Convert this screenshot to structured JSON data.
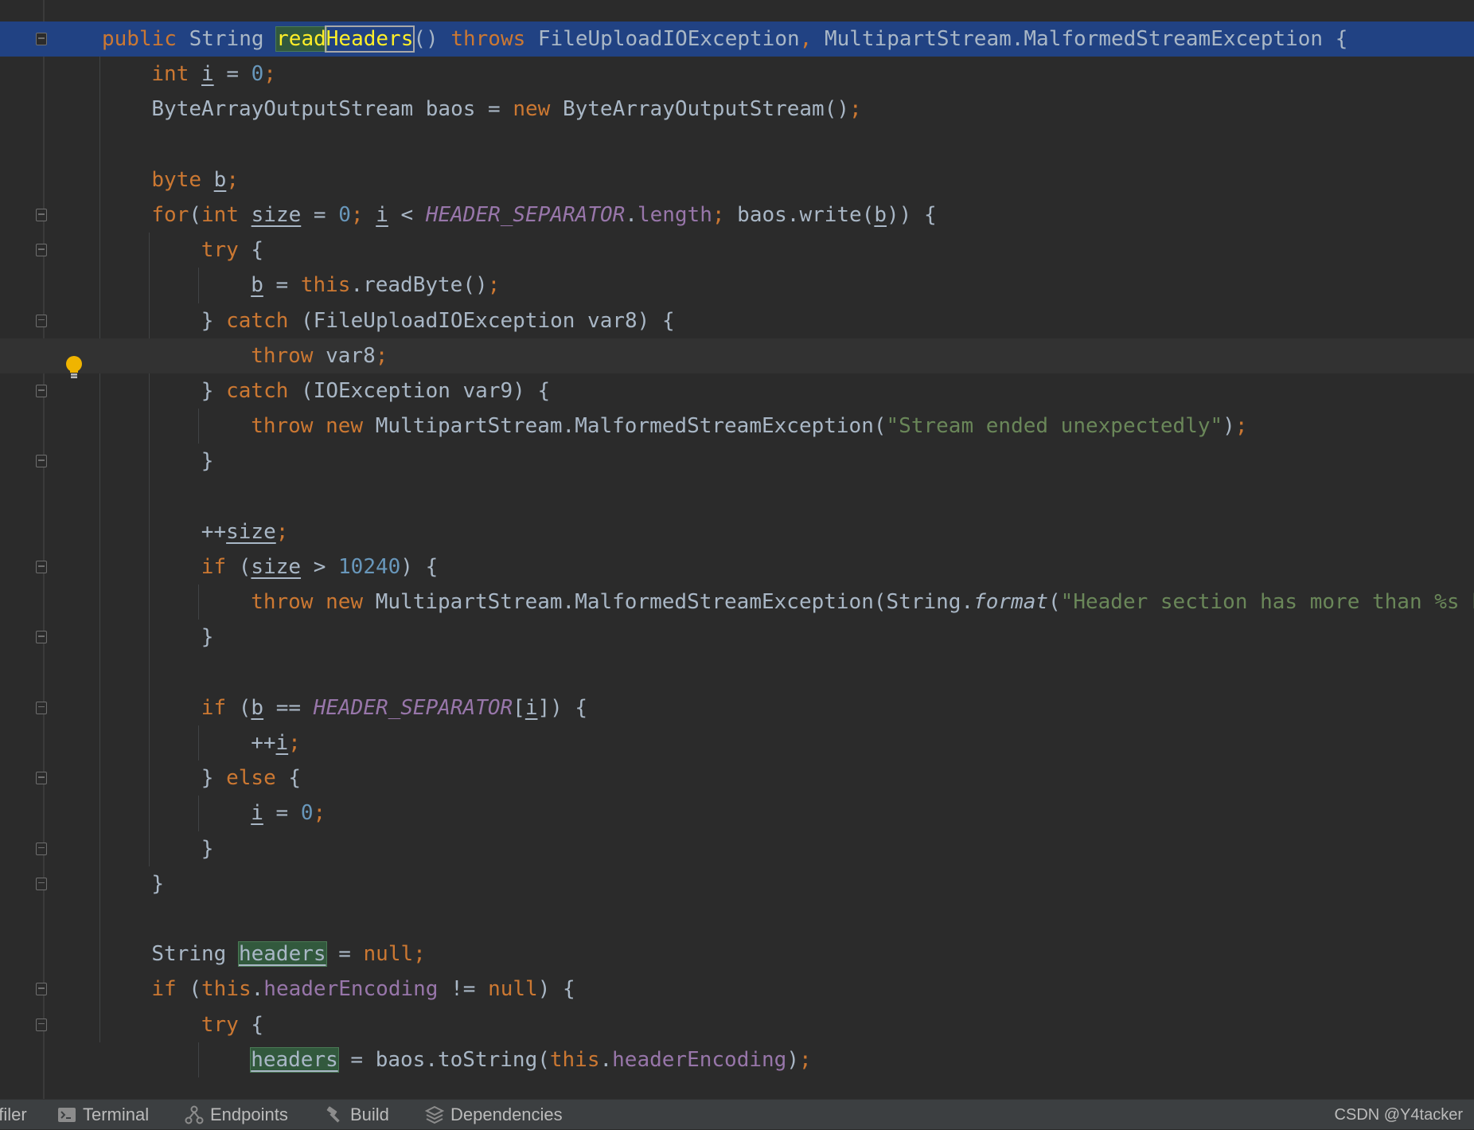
{
  "editor": {
    "lines": [
      {
        "indent": 0,
        "segs": [
          [
            "kw",
            "public "
          ],
          [
            "ty",
            "String "
          ],
          [
            "mh",
            "read"
          ],
          [
            "mh2",
            "Headers"
          ],
          [
            "ty",
            "() "
          ],
          [
            "kw",
            "throws "
          ],
          [
            "ty",
            "FileUploadIOException"
          ],
          [
            "kw",
            ", "
          ],
          [
            "ty",
            "MultipartStream.MalformedStreamException {"
          ]
        ]
      },
      {
        "indent": 1,
        "segs": [
          [
            "kw",
            "int "
          ],
          [
            "u",
            "i"
          ],
          [
            "ty",
            " = "
          ],
          [
            "num",
            "0"
          ],
          [
            "kw",
            ";"
          ]
        ]
      },
      {
        "indent": 1,
        "segs": [
          [
            "ty",
            "ByteArrayOutputStream baos = "
          ],
          [
            "kw",
            "new "
          ],
          [
            "ty",
            "ByteArrayOutputStream()"
          ],
          [
            "kw",
            ";"
          ]
        ]
      },
      {
        "indent": 1,
        "segs": []
      },
      {
        "indent": 1,
        "segs": [
          [
            "kw",
            "byte "
          ],
          [
            "u",
            "b"
          ],
          [
            "kw",
            ";"
          ]
        ]
      },
      {
        "indent": 1,
        "segs": [
          [
            "kw",
            "for"
          ],
          [
            "ty",
            "("
          ],
          [
            "kw",
            "int "
          ],
          [
            "u",
            "size"
          ],
          [
            "ty",
            " = "
          ],
          [
            "num",
            "0"
          ],
          [
            "kw",
            "; "
          ],
          [
            "u",
            "i"
          ],
          [
            "ty",
            " < "
          ],
          [
            "cst",
            "HEADER_SEPARATOR"
          ],
          [
            "ty",
            "."
          ],
          [
            "fld",
            "length"
          ],
          [
            "kw",
            "; "
          ],
          [
            "ty",
            "baos.write("
          ],
          [
            "u",
            "b"
          ],
          [
            "ty",
            ")) {"
          ]
        ]
      },
      {
        "indent": 2,
        "segs": [
          [
            "kw",
            "try "
          ],
          [
            "ty",
            "{"
          ]
        ]
      },
      {
        "indent": 3,
        "segs": [
          [
            "u",
            "b"
          ],
          [
            "ty",
            " = "
          ],
          [
            "kw",
            "this"
          ],
          [
            "ty",
            ".readByte()"
          ],
          [
            "kw",
            ";"
          ]
        ]
      },
      {
        "indent": 2,
        "segs": [
          [
            "ty",
            "} "
          ],
          [
            "kw",
            "catch "
          ],
          [
            "ty",
            "(FileUploadIOException var8) {"
          ]
        ]
      },
      {
        "indent": 3,
        "segs": [
          [
            "kw",
            "throw "
          ],
          [
            "ty",
            "var8"
          ],
          [
            "kw",
            ";"
          ]
        ]
      },
      {
        "indent": 2,
        "segs": [
          [
            "ty",
            "} "
          ],
          [
            "kw",
            "catch "
          ],
          [
            "ty",
            "(IOException var9) {"
          ]
        ]
      },
      {
        "indent": 3,
        "segs": [
          [
            "kw",
            "throw new "
          ],
          [
            "ty",
            "MultipartStream.MalformedStreamException("
          ],
          [
            "str",
            "\"Stream ended unexpectedly\""
          ],
          [
            "ty",
            ")"
          ],
          [
            "kw",
            ";"
          ]
        ]
      },
      {
        "indent": 2,
        "segs": [
          [
            "ty",
            "}"
          ]
        ]
      },
      {
        "indent": 2,
        "segs": []
      },
      {
        "indent": 2,
        "segs": [
          [
            "ty",
            "++"
          ],
          [
            "u",
            "size"
          ],
          [
            "kw",
            ";"
          ]
        ]
      },
      {
        "indent": 2,
        "segs": [
          [
            "kw",
            "if "
          ],
          [
            "ty",
            "("
          ],
          [
            "u",
            "size"
          ],
          [
            "ty",
            " > "
          ],
          [
            "num",
            "10240"
          ],
          [
            "ty",
            ") {"
          ]
        ]
      },
      {
        "indent": 3,
        "segs": [
          [
            "kw",
            "throw new "
          ],
          [
            "ty",
            "MultipartStream.MalformedStreamException(String."
          ],
          [
            "it",
            "format"
          ],
          [
            "ty",
            "("
          ],
          [
            "str",
            "\"Header section has more than %s bytes (maybe it is not properly terminated)\""
          ]
        ]
      },
      {
        "indent": 2,
        "segs": [
          [
            "ty",
            "}"
          ]
        ]
      },
      {
        "indent": 2,
        "segs": []
      },
      {
        "indent": 2,
        "segs": [
          [
            "kw",
            "if "
          ],
          [
            "ty",
            "("
          ],
          [
            "u",
            "b"
          ],
          [
            "ty",
            " == "
          ],
          [
            "cst",
            "HEADER_SEPARATOR"
          ],
          [
            "ty",
            "["
          ],
          [
            "u",
            "i"
          ],
          [
            "ty",
            "]) {"
          ]
        ]
      },
      {
        "indent": 3,
        "segs": [
          [
            "ty",
            "++"
          ],
          [
            "u",
            "i"
          ],
          [
            "kw",
            ";"
          ]
        ]
      },
      {
        "indent": 2,
        "segs": [
          [
            "ty",
            "} "
          ],
          [
            "kw",
            "else "
          ],
          [
            "ty",
            "{"
          ]
        ]
      },
      {
        "indent": 3,
        "segs": [
          [
            "u",
            "i"
          ],
          [
            "ty",
            " = "
          ],
          [
            "num",
            "0"
          ],
          [
            "kw",
            ";"
          ]
        ]
      },
      {
        "indent": 2,
        "segs": [
          [
            "ty",
            "}"
          ]
        ]
      },
      {
        "indent": 1,
        "segs": [
          [
            "ty",
            "}"
          ]
        ]
      },
      {
        "indent": 1,
        "segs": []
      },
      {
        "indent": 1,
        "segs": [
          [
            "ty",
            "String "
          ],
          [
            "vh",
            "headers"
          ],
          [
            "ty",
            " = "
          ],
          [
            "kw",
            "null;"
          ]
        ]
      },
      {
        "indent": 1,
        "segs": [
          [
            "kw",
            "if "
          ],
          [
            "ty",
            "("
          ],
          [
            "kw",
            "this"
          ],
          [
            "ty",
            "."
          ],
          [
            "fld",
            "headerEncoding"
          ],
          [
            "ty",
            " != "
          ],
          [
            "kw",
            "null"
          ],
          [
            "ty",
            ") {"
          ]
        ]
      },
      {
        "indent": 2,
        "segs": [
          [
            "kw",
            "try "
          ],
          [
            "ty",
            "{"
          ]
        ]
      },
      {
        "indent": 3,
        "segs": [
          [
            "vh",
            "headers"
          ],
          [
            "ty",
            " = baos.toString("
          ],
          [
            "kw",
            "this"
          ],
          [
            "ty",
            "."
          ],
          [
            "fld",
            "headerEncoding"
          ],
          [
            "ty",
            ")"
          ],
          [
            "kw",
            ";"
          ]
        ]
      }
    ]
  },
  "statusbar": {
    "profiler_label": "Profiler",
    "terminal_label": "Terminal",
    "endpoints_label": "Endpoints",
    "build_label": "Build",
    "dependencies_label": "Dependencies",
    "watermark": "CSDN @Y4tacker"
  }
}
